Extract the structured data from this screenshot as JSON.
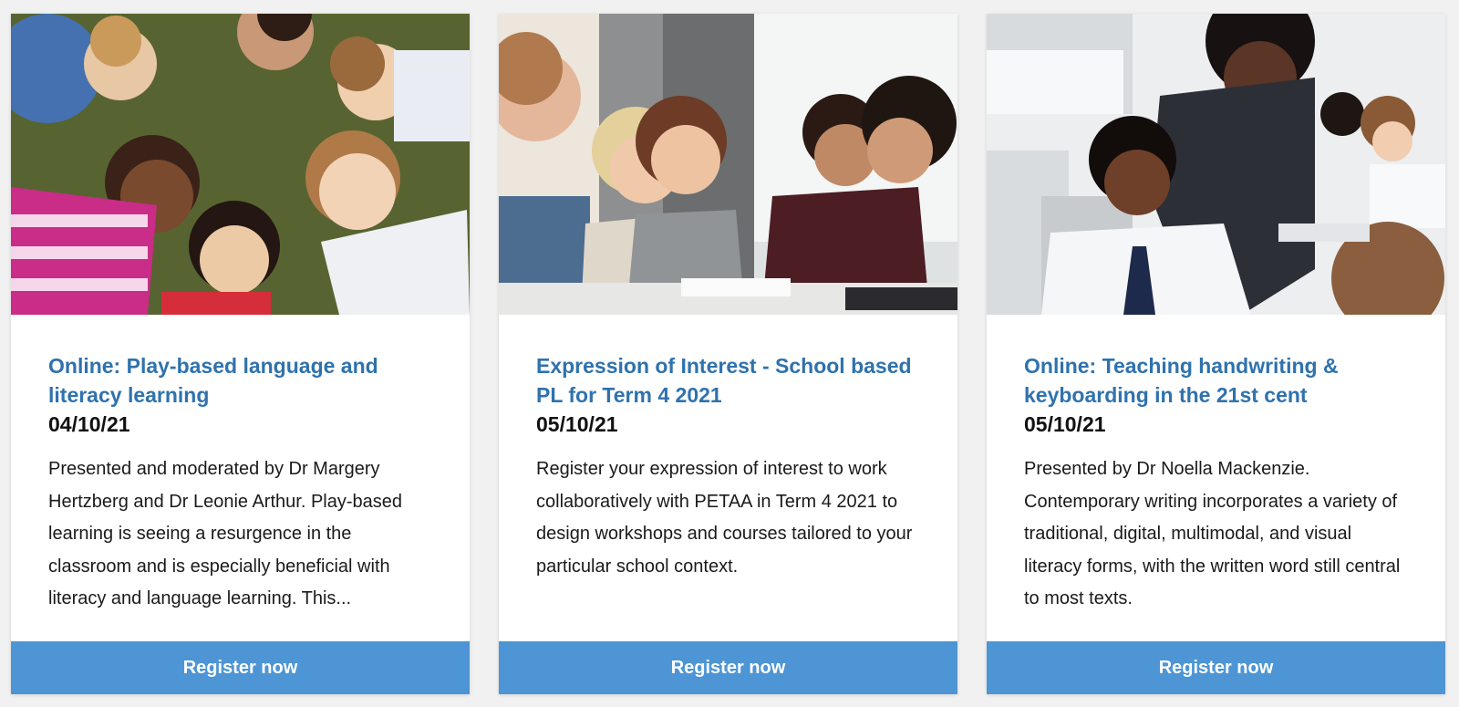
{
  "cards": [
    {
      "photo_icon": "children-lying-on-grass-photo",
      "title": "Online: Play-based language and literacy learning",
      "date": "04/10/21",
      "description": "Presented and moderated by Dr Margery Hertzberg and Dr Leonie Arthur. Play-based learning is seeing a resurgence in the classroom and is especially beneficial with literacy and language learning. This...",
      "button": "Register now"
    },
    {
      "photo_icon": "adults-collaborating-at-table-photo",
      "title": "Expression of Interest - School based PL for Term 4 2021",
      "date": "05/10/21",
      "description": "Register your expression of interest to work collaboratively with PETAA in Term 4 2021 to design workshops and courses tailored to your particular school context.",
      "button": "Register now"
    },
    {
      "photo_icon": "teacher-helping-student-write-photo",
      "title": "Online: Teaching handwriting & keyboarding in the 21st cent",
      "date": "05/10/21",
      "description": "Presented by Dr Noella Mackenzie.  Contemporary writing incorporates a variety of traditional, digital, multimodal, and visual literacy forms, with the written word still central to most texts.",
      "button": "Register now"
    }
  ],
  "colors": {
    "title": "#2f72ad",
    "button_bg": "#4d95d4",
    "page_bg": "#f1f1f1"
  }
}
